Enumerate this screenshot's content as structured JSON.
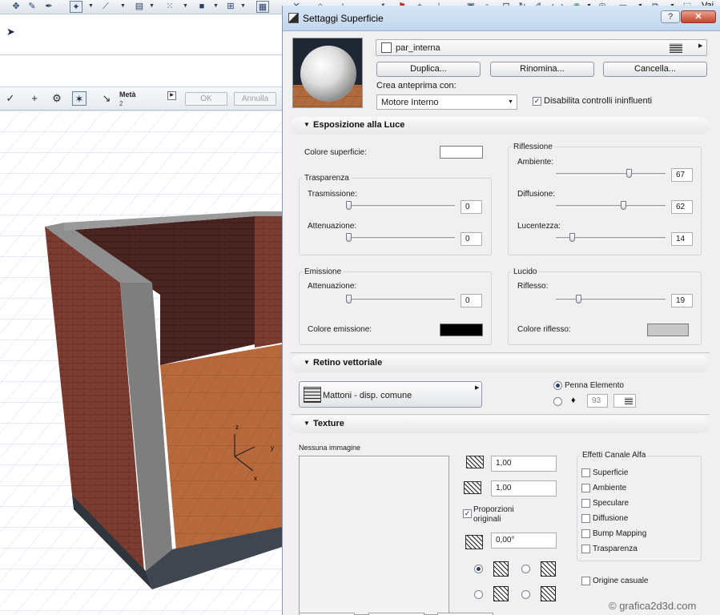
{
  "toolbar": {
    "vai_label": "Vai"
  },
  "infobox": {
    "meta_label": "Metà",
    "meta_value": "2",
    "ok_label": "OK",
    "annulla_label": "Annulla"
  },
  "dialog": {
    "title": "Settaggi Superficie",
    "help_label": "?",
    "close_label": "✕",
    "surface_name": "par_interna",
    "buttons": {
      "duplica": "Duplica...",
      "rinomina": "Rinomina...",
      "cancella": "Cancella..."
    },
    "anteprima_label": "Crea anteprima con:",
    "engine_value": "Motore Interno",
    "disabilita_label": "Disabilita controlli ininfluenti",
    "disabilita_checked": true
  },
  "luce": {
    "header": "Esposizione alla Luce",
    "colore_superficie_label": "Colore superficie:",
    "colore_superficie": "#ffffff",
    "trasparenza": {
      "title": "Trasparenza",
      "trasmissione_label": "Trasmissione:",
      "trasmissione_value": "0",
      "attenuazione_label": "Attenuazione:",
      "attenuazione_value": "0"
    },
    "riflessione": {
      "title": "Riflessione",
      "ambiente_label": "Ambiente:",
      "ambiente_value": "67",
      "diffusione_label": "Diffusione:",
      "diffusione_value": "62",
      "lucentezza_label": "Lucentezza:",
      "lucentezza_value": "14"
    },
    "emissione": {
      "title": "Emissione",
      "attenuazione_label": "Attenuazione:",
      "attenuazione_value": "0",
      "colore_label": "Colore emissione:",
      "colore": "#000000"
    },
    "lucido": {
      "title": "Lucido",
      "riflesso_label": "Riflesso:",
      "riflesso_value": "19",
      "colore_label": "Colore riflesso:",
      "colore": "#c8c8c8"
    }
  },
  "retino": {
    "header": "Retino vettoriale",
    "pattern_label": "Mattoni - disp. comune",
    "penna_label": "Penna Elemento",
    "pen_number": "93"
  },
  "texture": {
    "header": "Texture",
    "nessuna_immagine": "Nessuna immagine",
    "width_value": "1,00",
    "height_value": "1,00",
    "proporzioni_label_line1": "Proporzioni",
    "proporzioni_label_line2": "originali",
    "proporzioni_checked": true,
    "angle_value": "0,00°",
    "effetti_title": "Effetti Canale Alfa",
    "effetti": [
      "Superficie",
      "Ambiente",
      "Speculare",
      "Diffusione",
      "Bump Mapping",
      "Trasparenza"
    ],
    "origine_label": "Origine casuale"
  },
  "watermark": "© grafica2d3d.com",
  "colors": {
    "dialog_bg": "#f0f0f0",
    "titlebar": "#c9dcf1",
    "brick": "#7a3b2e",
    "floor": "#b5683a",
    "wall_top": "#8e8e8e"
  }
}
